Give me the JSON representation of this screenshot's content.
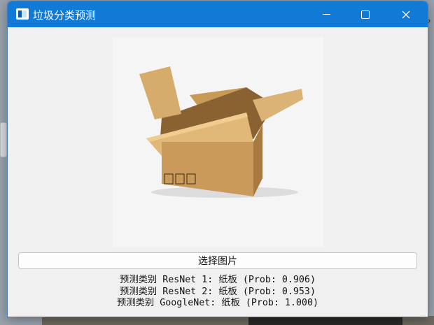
{
  "window": {
    "title": "垃圾分类预测",
    "icons": {
      "app": "app-window-icon",
      "minimize": "minimize-icon",
      "maximize": "maximize-icon",
      "close": "close-icon"
    }
  },
  "image": {
    "subject": "cardboard-box-photo"
  },
  "select_button": {
    "label": "选择图片"
  },
  "results": [
    {
      "text": "预测类别 ResNet 1: 纸板 (Prob: 0.906)"
    },
    {
      "text": "预测类别 ResNet 2: 纸板 (Prob: 0.953)"
    },
    {
      "text": "预测类别 GoogleNet: 纸板 (Prob: 1.000)"
    }
  ],
  "desktop": {
    "partial_char": "?"
  },
  "colors": {
    "titlebar": "#1179d6",
    "window_bg": "#f0f0f0",
    "box_light": "#d8ac6a",
    "box_dark": "#b07f40"
  }
}
